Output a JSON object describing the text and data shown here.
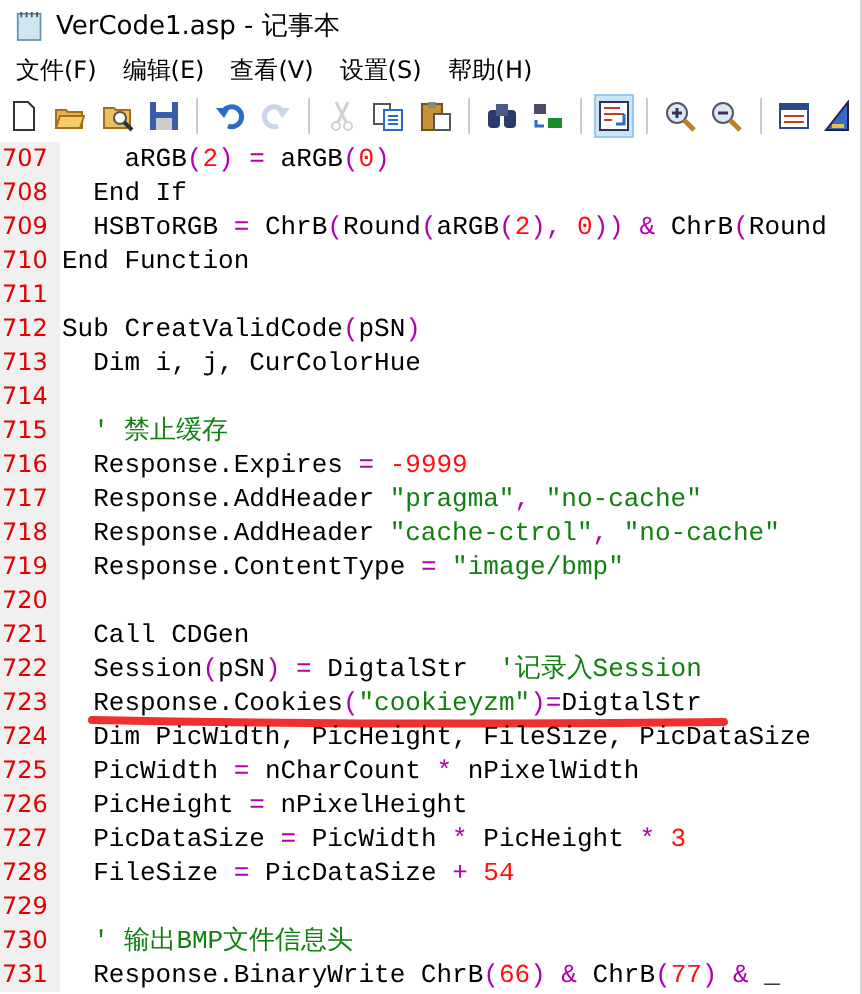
{
  "window": {
    "title": "VerCode1.asp - 记事本"
  },
  "menu": [
    "文件(F)",
    "编辑(E)",
    "查看(V)",
    "设置(S)",
    "帮助(H)"
  ],
  "toolbar": [
    {
      "kind": "new",
      "disabled": false,
      "on": false
    },
    {
      "kind": "open",
      "disabled": false,
      "on": false
    },
    {
      "kind": "browse",
      "disabled": false,
      "on": false
    },
    {
      "kind": "save",
      "disabled": false,
      "on": false
    },
    {
      "kind": "sep"
    },
    {
      "kind": "undo",
      "disabled": false,
      "on": false
    },
    {
      "kind": "redo",
      "disabled": true,
      "on": false
    },
    {
      "kind": "sep"
    },
    {
      "kind": "cut",
      "disabled": true,
      "on": false
    },
    {
      "kind": "copy",
      "disabled": false,
      "on": false
    },
    {
      "kind": "paste",
      "disabled": false,
      "on": false
    },
    {
      "kind": "sep"
    },
    {
      "kind": "find",
      "disabled": false,
      "on": false
    },
    {
      "kind": "replace",
      "disabled": false,
      "on": false
    },
    {
      "kind": "sep"
    },
    {
      "kind": "wrap",
      "disabled": false,
      "on": true
    },
    {
      "kind": "sep"
    },
    {
      "kind": "zoomin",
      "disabled": false,
      "on": false
    },
    {
      "kind": "zoomout",
      "disabled": false,
      "on": false
    },
    {
      "kind": "sep"
    },
    {
      "kind": "window",
      "disabled": false,
      "on": false
    },
    {
      "kind": "settings",
      "disabled": false,
      "on": false
    }
  ],
  "editor": {
    "lines": [
      {
        "number": "707",
        "tokens": [
          {
            "kind": "text",
            "text": "    aRGB"
          },
          {
            "kind": "op",
            "text": "("
          },
          {
            "kind": "num",
            "text": "2"
          },
          {
            "kind": "op",
            "text": ")"
          },
          {
            "kind": "op",
            "text": " ="
          },
          {
            "kind": "text",
            "text": " aRGB"
          },
          {
            "kind": "op",
            "text": "("
          },
          {
            "kind": "num",
            "text": "0"
          },
          {
            "kind": "op",
            "text": ")"
          }
        ]
      },
      {
        "number": "708",
        "tokens": [
          {
            "kind": "text",
            "text": "  End If"
          }
        ]
      },
      {
        "number": "709",
        "tokens": [
          {
            "kind": "text",
            "text": "  HSBToRGB "
          },
          {
            "kind": "op",
            "text": "="
          },
          {
            "kind": "text",
            "text": " ChrB"
          },
          {
            "kind": "op",
            "text": "("
          },
          {
            "kind": "text",
            "text": "Round"
          },
          {
            "kind": "op",
            "text": "("
          },
          {
            "kind": "text",
            "text": "aRGB"
          },
          {
            "kind": "op",
            "text": "("
          },
          {
            "kind": "num",
            "text": "2"
          },
          {
            "kind": "op",
            "text": "),"
          },
          {
            "kind": "num",
            "text": " 0"
          },
          {
            "kind": "op",
            "text": "))"
          },
          {
            "kind": "op",
            "text": " &"
          },
          {
            "kind": "text",
            "text": " ChrB"
          },
          {
            "kind": "op",
            "text": "("
          },
          {
            "kind": "text",
            "text": "Round"
          }
        ]
      },
      {
        "number": "710",
        "tokens": [
          {
            "kind": "text",
            "text": "End Function"
          }
        ]
      },
      {
        "number": "711"
      },
      {
        "number": "712",
        "tokens": [
          {
            "kind": "text",
            "text": "Sub CreatValidCode"
          },
          {
            "kind": "op",
            "text": "("
          },
          {
            "kind": "text",
            "text": "pSN"
          },
          {
            "kind": "op",
            "text": ")"
          }
        ]
      },
      {
        "number": "713",
        "tokens": [
          {
            "kind": "text",
            "text": "  Dim i, j, CurColorHue"
          }
        ]
      },
      {
        "number": "714"
      },
      {
        "number": "715",
        "tokens": [
          {
            "kind": "comment",
            "text": "  ' 禁止缓存"
          }
        ]
      },
      {
        "number": "716",
        "tokens": [
          {
            "kind": "text",
            "text": "  Response.Expires "
          },
          {
            "kind": "op",
            "text": "="
          },
          {
            "kind": "num",
            "text": " -9999"
          }
        ]
      },
      {
        "number": "717",
        "tokens": [
          {
            "kind": "text",
            "text": "  Response.AddHeader "
          },
          {
            "kind": "str",
            "text": "\"pragma\""
          },
          {
            "kind": "op",
            "text": ","
          },
          {
            "kind": "str",
            "text": " \"no-cache\""
          }
        ]
      },
      {
        "number": "718",
        "tokens": [
          {
            "kind": "text",
            "text": "  Response.AddHeader "
          },
          {
            "kind": "str",
            "text": "\"cache-ctrol\""
          },
          {
            "kind": "op",
            "text": ","
          },
          {
            "kind": "str",
            "text": " \"no-cache\""
          }
        ]
      },
      {
        "number": "719",
        "tokens": [
          {
            "kind": "text",
            "text": "  Response.ContentType "
          },
          {
            "kind": "op",
            "text": "="
          },
          {
            "kind": "str",
            "text": " \"image/bmp\""
          }
        ]
      },
      {
        "number": "720"
      },
      {
        "number": "721",
        "tokens": [
          {
            "kind": "text",
            "text": "  Call CDGen"
          }
        ]
      },
      {
        "number": "722",
        "tokens": [
          {
            "kind": "text",
            "text": "  Session"
          },
          {
            "kind": "op",
            "text": "("
          },
          {
            "kind": "text",
            "text": "pSN"
          },
          {
            "kind": "op",
            "text": ")"
          },
          {
            "kind": "op",
            "text": " ="
          },
          {
            "kind": "text",
            "text": " DigtalStr  "
          },
          {
            "kind": "comment",
            "text": "'记录入Session"
          }
        ]
      },
      {
        "number": "723",
        "underlined": true,
        "tokens": [
          {
            "kind": "text",
            "text": "  Response.Cookies"
          },
          {
            "kind": "op",
            "text": "("
          },
          {
            "kind": "str",
            "text": "\"cookieyzm\""
          },
          {
            "kind": "op",
            "text": ")="
          },
          {
            "kind": "text",
            "text": "DigtalStr"
          }
        ]
      },
      {
        "number": "724",
        "tokens": [
          {
            "kind": "text",
            "text": "  Dim PicWidth, PicHeight, FileSize, PicDataSize"
          }
        ]
      },
      {
        "number": "725",
        "tokens": [
          {
            "kind": "text",
            "text": "  PicWidth "
          },
          {
            "kind": "op",
            "text": "="
          },
          {
            "kind": "text",
            "text": " nCharCount "
          },
          {
            "kind": "op",
            "text": "*"
          },
          {
            "kind": "text",
            "text": " nPixelWidth"
          }
        ]
      },
      {
        "number": "726",
        "tokens": [
          {
            "kind": "text",
            "text": "  PicHeight "
          },
          {
            "kind": "op",
            "text": "="
          },
          {
            "kind": "text",
            "text": " nPixelHeight"
          }
        ]
      },
      {
        "number": "727",
        "tokens": [
          {
            "kind": "text",
            "text": "  PicDataSize "
          },
          {
            "kind": "op",
            "text": "="
          },
          {
            "kind": "text",
            "text": " PicWidth "
          },
          {
            "kind": "op",
            "text": "*"
          },
          {
            "kind": "text",
            "text": " PicHeight "
          },
          {
            "kind": "op",
            "text": "*"
          },
          {
            "kind": "num",
            "text": " 3"
          }
        ]
      },
      {
        "number": "728",
        "tokens": [
          {
            "kind": "text",
            "text": "  FileSize "
          },
          {
            "kind": "op",
            "text": "="
          },
          {
            "kind": "text",
            "text": " PicDataSize "
          },
          {
            "kind": "op",
            "text": "+"
          },
          {
            "kind": "num",
            "text": " 54"
          }
        ]
      },
      {
        "number": "729"
      },
      {
        "number": "730",
        "tokens": [
          {
            "kind": "comment",
            "text": "  ' 输出BMP文件信息头"
          }
        ]
      },
      {
        "number": "731",
        "tokens": [
          {
            "kind": "text",
            "text": "  Response.BinaryWrite ChrB"
          },
          {
            "kind": "op",
            "text": "("
          },
          {
            "kind": "num",
            "text": "66"
          },
          {
            "kind": "op",
            "text": ")"
          },
          {
            "kind": "op",
            "text": " &"
          },
          {
            "kind": "text",
            "text": " ChrB"
          },
          {
            "kind": "op",
            "text": "("
          },
          {
            "kind": "num",
            "text": "77"
          },
          {
            "kind": "op",
            "text": ")"
          },
          {
            "kind": "op",
            "text": " &"
          },
          {
            "kind": "text",
            "text": " _"
          }
        ]
      }
    ]
  }
}
